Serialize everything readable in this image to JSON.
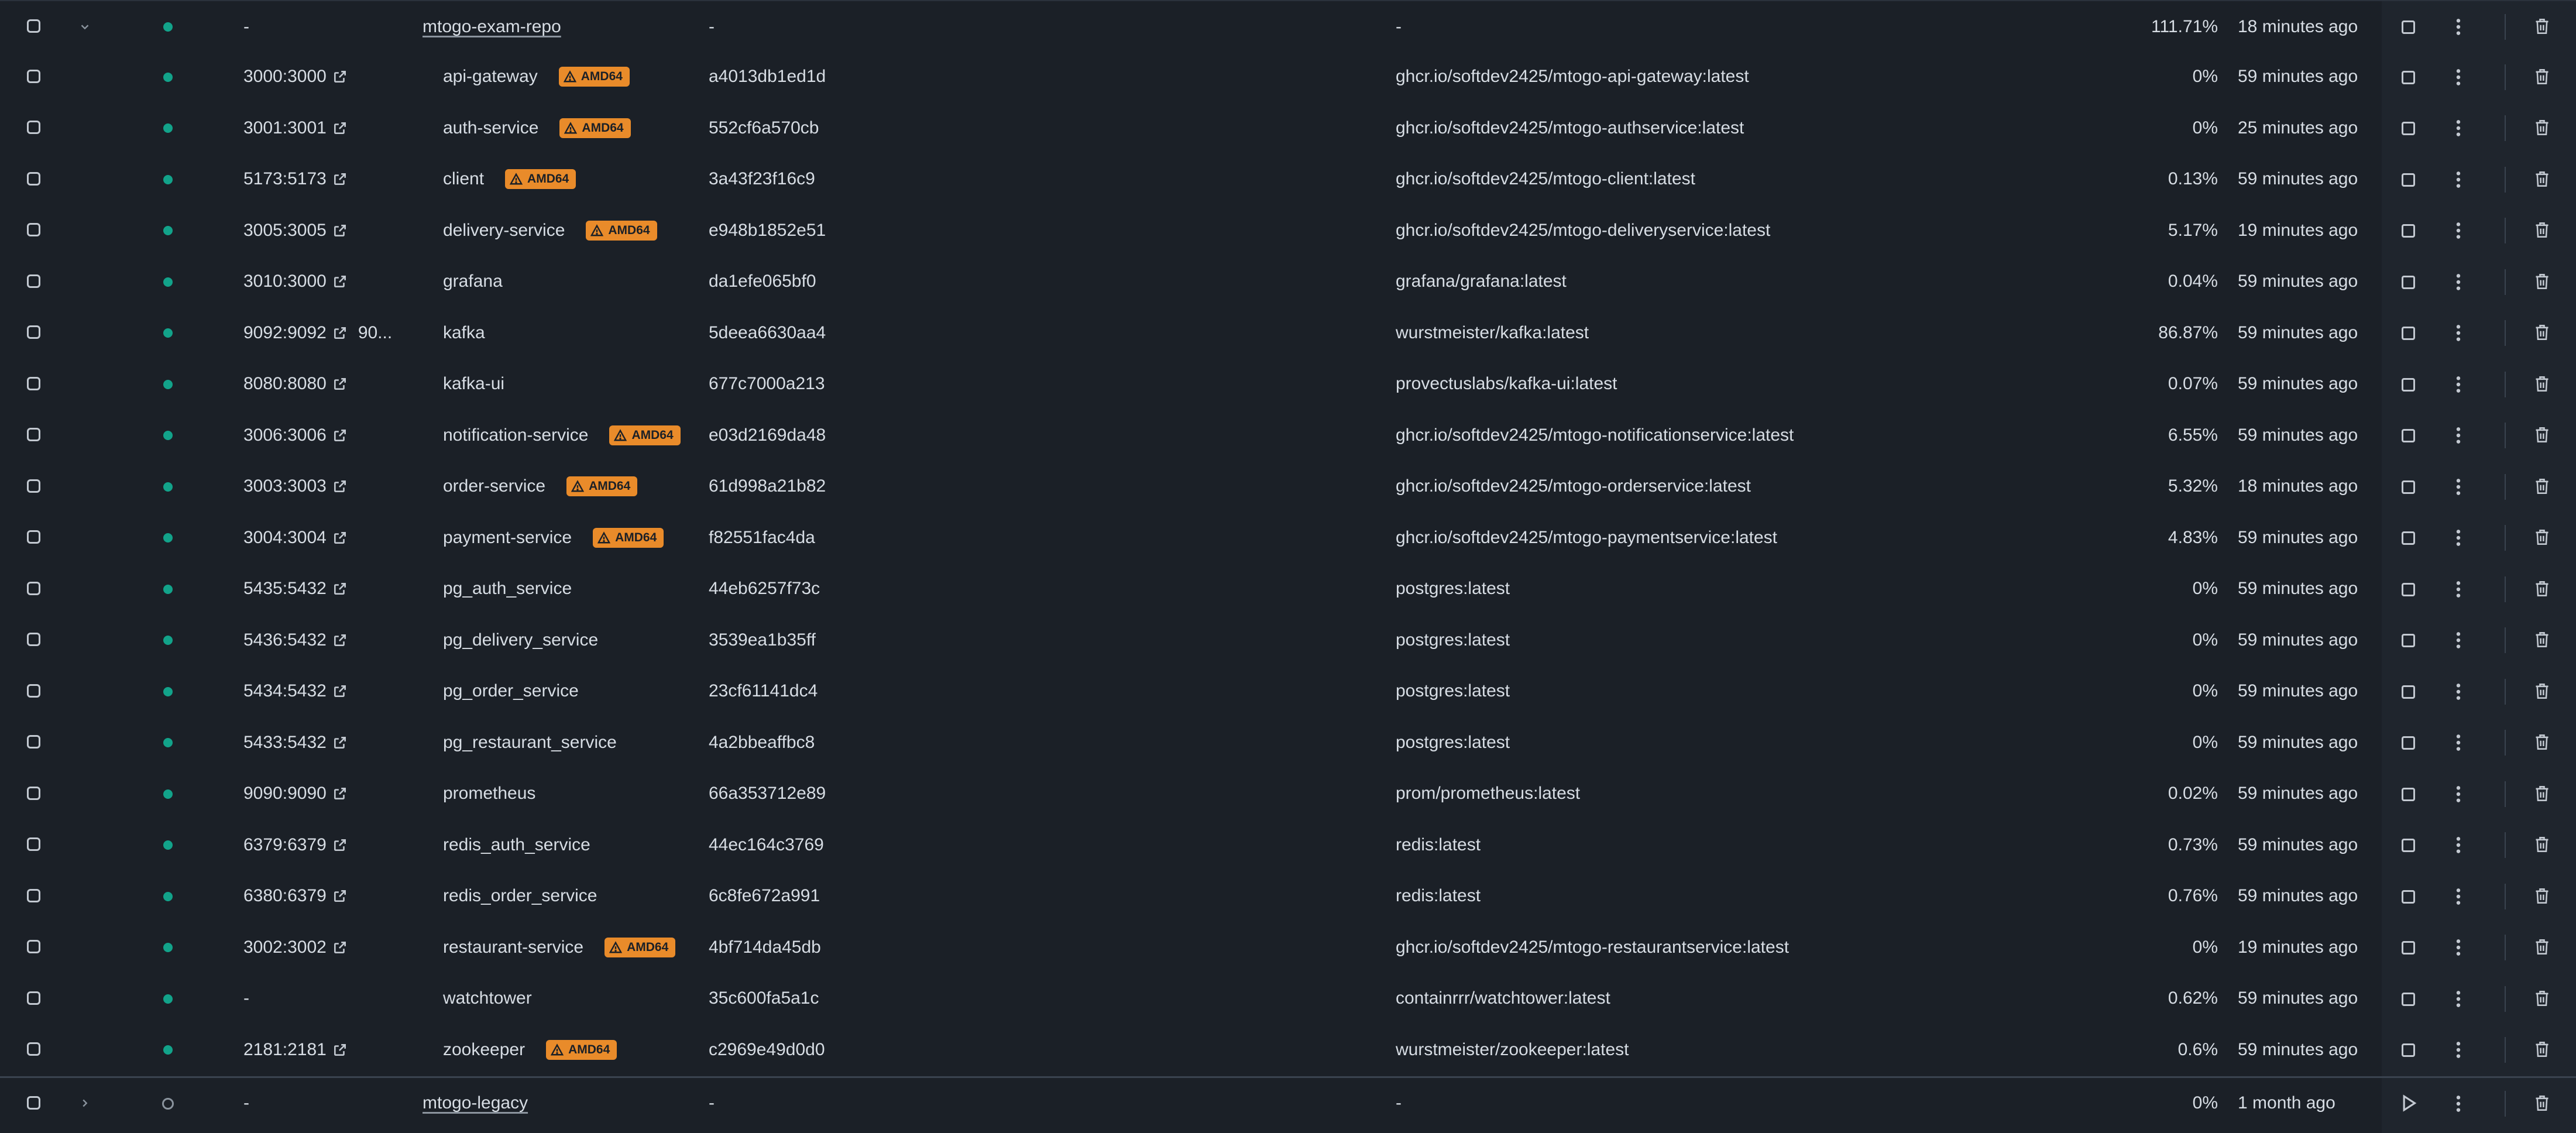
{
  "table": {
    "groups": [
      {
        "name": "mtogo-exam-repo",
        "expanded": true,
        "status": "running",
        "port": "-",
        "container_id": "-",
        "image": "-",
        "cpu": "111.71%",
        "last_started": "18 minutes ago",
        "action_icon": "stop-icon",
        "containers": [
          {
            "port": "3000:3000",
            "name": "api-gateway",
            "badge": "AMD64",
            "container_id": "a4013db1ed1d",
            "image": "ghcr.io/softdev2425/mtogo-api-gateway:latest",
            "cpu": "0%",
            "last_started": "59 minutes ago"
          },
          {
            "port": "3001:3001",
            "name": "auth-service",
            "badge": "AMD64",
            "container_id": "552cf6a570cb",
            "image": "ghcr.io/softdev2425/mtogo-authservice:latest",
            "cpu": "0%",
            "last_started": "25 minutes ago"
          },
          {
            "port": "5173:5173",
            "name": "client",
            "badge": "AMD64",
            "container_id": "3a43f23f16c9",
            "image": "ghcr.io/softdev2425/mtogo-client:latest",
            "cpu": "0.13%",
            "last_started": "59 minutes ago"
          },
          {
            "port": "3005:3005",
            "name": "delivery-service",
            "badge": "AMD64",
            "container_id": "e948b1852e51",
            "image": "ghcr.io/softdev2425/mtogo-deliveryservice:latest",
            "cpu": "5.17%",
            "last_started": "19 minutes ago"
          },
          {
            "port": "3010:3000",
            "name": "grafana",
            "badge": "",
            "container_id": "da1efe065bf0",
            "image": "grafana/grafana:latest",
            "cpu": "0.04%",
            "last_started": "59 minutes ago"
          },
          {
            "port": "9092:9092",
            "port_more": "90...",
            "name": "kafka",
            "badge": "",
            "container_id": "5deea6630aa4",
            "image": "wurstmeister/kafka:latest",
            "cpu": "86.87%",
            "last_started": "59 minutes ago"
          },
          {
            "port": "8080:8080",
            "name": "kafka-ui",
            "badge": "",
            "container_id": "677c7000a213",
            "image": "provectuslabs/kafka-ui:latest",
            "cpu": "0.07%",
            "last_started": "59 minutes ago"
          },
          {
            "port": "3006:3006",
            "name": "notification-service",
            "badge": "AMD64",
            "container_id": "e03d2169da48",
            "image": "ghcr.io/softdev2425/mtogo-notificationservice:latest",
            "cpu": "6.55%",
            "last_started": "59 minutes ago"
          },
          {
            "port": "3003:3003",
            "name": "order-service",
            "badge": "AMD64",
            "container_id": "61d998a21b82",
            "image": "ghcr.io/softdev2425/mtogo-orderservice:latest",
            "cpu": "5.32%",
            "last_started": "18 minutes ago"
          },
          {
            "port": "3004:3004",
            "name": "payment-service",
            "badge": "AMD64",
            "container_id": "f82551fac4da",
            "image": "ghcr.io/softdev2425/mtogo-paymentservice:latest",
            "cpu": "4.83%",
            "last_started": "59 minutes ago"
          },
          {
            "port": "5435:5432",
            "name": "pg_auth_service",
            "badge": "",
            "container_id": "44eb6257f73c",
            "image": "postgres:latest",
            "cpu": "0%",
            "last_started": "59 minutes ago"
          },
          {
            "port": "5436:5432",
            "name": "pg_delivery_service",
            "badge": "",
            "container_id": "3539ea1b35ff",
            "image": "postgres:latest",
            "cpu": "0%",
            "last_started": "59 minutes ago"
          },
          {
            "port": "5434:5432",
            "name": "pg_order_service",
            "badge": "",
            "container_id": "23cf61141dc4",
            "image": "postgres:latest",
            "cpu": "0%",
            "last_started": "59 minutes ago"
          },
          {
            "port": "5433:5432",
            "name": "pg_restaurant_service",
            "badge": "",
            "container_id": "4a2bbeaffbc8",
            "image": "postgres:latest",
            "cpu": "0%",
            "last_started": "59 minutes ago"
          },
          {
            "port": "9090:9090",
            "name": "prometheus",
            "badge": "",
            "container_id": "66a353712e89",
            "image": "prom/prometheus:latest",
            "cpu": "0.02%",
            "last_started": "59 minutes ago"
          },
          {
            "port": "6379:6379",
            "name": "redis_auth_service",
            "badge": "",
            "container_id": "44ec164c3769",
            "image": "redis:latest",
            "cpu": "0.73%",
            "last_started": "59 minutes ago"
          },
          {
            "port": "6380:6379",
            "name": "redis_order_service",
            "badge": "",
            "container_id": "6c8fe672a991",
            "image": "redis:latest",
            "cpu": "0.76%",
            "last_started": "59 minutes ago"
          },
          {
            "port": "3002:3002",
            "name": "restaurant-service",
            "badge": "AMD64",
            "container_id": "4bf714da45db",
            "image": "ghcr.io/softdev2425/mtogo-restaurantservice:latest",
            "cpu": "0%",
            "last_started": "19 minutes ago"
          },
          {
            "port": "-",
            "name": "watchtower",
            "badge": "",
            "container_id": "35c600fa5a1c",
            "image": "containrrr/watchtower:latest",
            "cpu": "0.62%",
            "last_started": "59 minutes ago"
          },
          {
            "port": "2181:2181",
            "name": "zookeeper",
            "badge": "AMD64",
            "container_id": "c2969e49d0d0",
            "image": "wurstmeister/zookeeper:latest",
            "cpu": "0.6%",
            "last_started": "59 minutes ago"
          }
        ]
      },
      {
        "name": "mtogo-legacy",
        "expanded": false,
        "status": "stopped",
        "port": "-",
        "container_id": "-",
        "image": "-",
        "cpu": "0%",
        "last_started": "1 month ago",
        "action_icon": "play-icon",
        "containers": []
      }
    ]
  },
  "colors": {
    "background": "#1b2027",
    "running": "#12a38a",
    "badge": "#e98b2a",
    "text": "#d7dde4"
  }
}
